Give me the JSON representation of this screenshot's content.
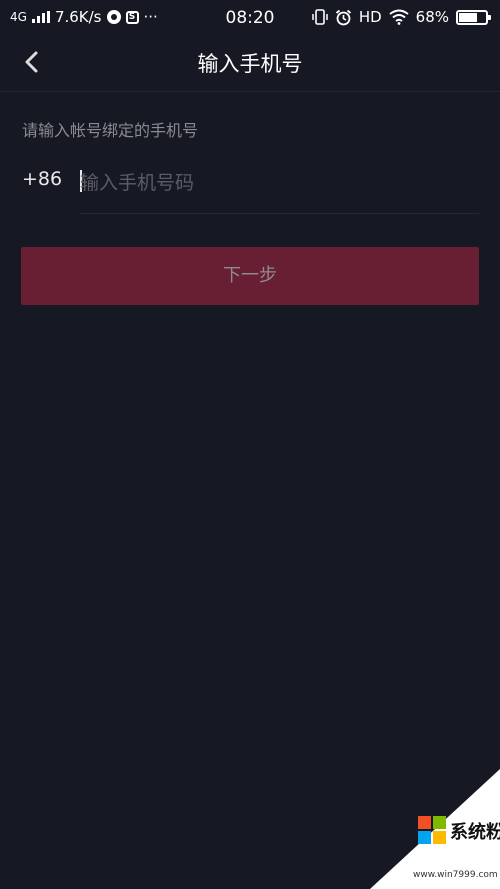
{
  "status_bar": {
    "network": "4G",
    "speed": "7.6K/s",
    "time": "08:20",
    "hd": "HD",
    "battery_percent": "68%",
    "battery_level": 0.68,
    "icons": [
      "signal-icon",
      "q-app-icon",
      "s-app-icon",
      "more-icon",
      "vibrate-icon",
      "alarm-icon",
      "wifi-icon",
      "battery-icon"
    ]
  },
  "nav": {
    "title": "输入手机号",
    "back_icon": "chevron-left-icon"
  },
  "form": {
    "hint": "请输入帐号绑定的手机号",
    "country_code": "+86",
    "phone_placeholder": "输入手机号码",
    "phone_value": "",
    "next_label": "下一步"
  },
  "watermark": {
    "brand": "系统粉",
    "url": "www.win7999.com",
    "colors": [
      "#f25022",
      "#7fba00",
      "#00a4ef",
      "#ffb900"
    ]
  },
  "colors": {
    "background": "#161823",
    "button": "#681e33",
    "hint_text": "#8a8b91"
  }
}
